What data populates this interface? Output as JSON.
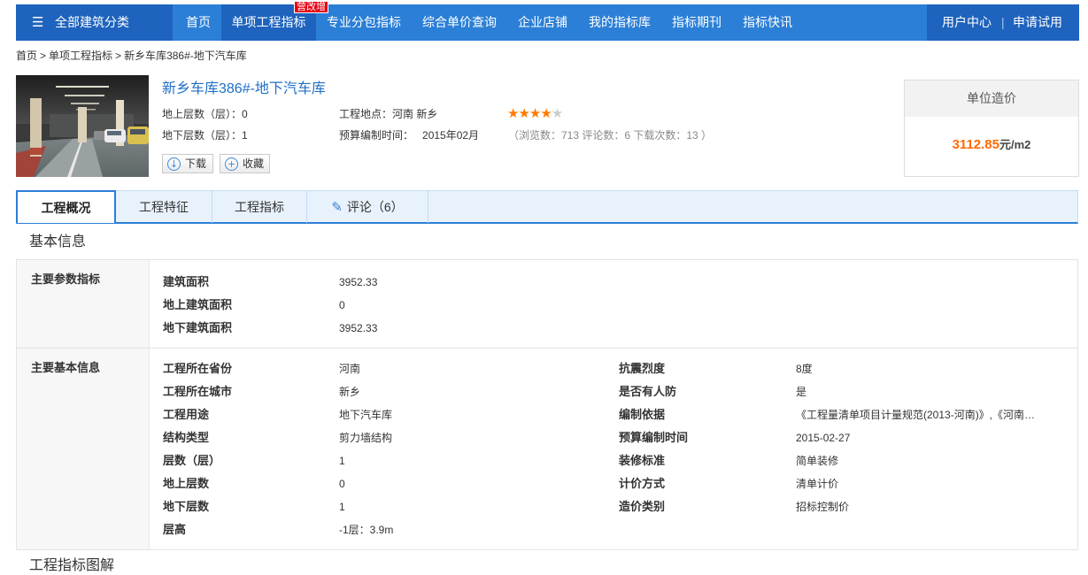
{
  "colors": {
    "nav_bg": "#2b7fd6",
    "nav_active": "#1e63bd",
    "badge": "#e60012",
    "link": "#1f6fc5",
    "price": "#ff6a00",
    "star_on": "#ff7a00",
    "star_off": "#cccccc"
  },
  "nav": {
    "category_icon": "menu-icon",
    "category_label": "全部建筑分类",
    "items": [
      {
        "label": "首页"
      },
      {
        "label": "单项工程指标",
        "badge": "营改增",
        "active": true
      },
      {
        "label": "专业分包指标"
      },
      {
        "label": "综合单价查询"
      },
      {
        "label": "企业店铺"
      },
      {
        "label": "我的指标库"
      },
      {
        "label": "指标期刊"
      },
      {
        "label": "指标快讯"
      }
    ],
    "user_center": "用户中心",
    "separator": "|",
    "trial": "申请试用"
  },
  "breadcrumb": {
    "separator": ">",
    "items": [
      "首页",
      "单项工程指标",
      "新乡车库386#-地下汽车库"
    ]
  },
  "project": {
    "title": "新乡车库386#-地下汽车库",
    "above_floors": "地上层数（层）：0",
    "below_floors": "地下层数（层）：1",
    "location": "工程地点：河南 新乡",
    "budget_time_label": "预算编制时间：",
    "budget_time": "2015年02月",
    "rating": 4,
    "rating_max": 5,
    "stats": "（浏览数：713 评论数：6 下载次数：13 ）",
    "download_label": "下载",
    "favorite_label": "收藏"
  },
  "unit_cost": {
    "title": "单位造价",
    "value": "3112.85",
    "unit": "元/m2"
  },
  "tabs": [
    {
      "label": "工程概况",
      "active": true
    },
    {
      "label": "工程特征"
    },
    {
      "label": "工程指标"
    },
    {
      "label": "评论（6）",
      "icon": "pencil-icon"
    }
  ],
  "basic_info": {
    "heading": "基本信息",
    "main_params": {
      "label": "主要参数指标",
      "rows": [
        {
          "name": "建筑面积",
          "value": "3952.33"
        },
        {
          "name": "地上建筑面积",
          "value": "0"
        },
        {
          "name": "地下建筑面积",
          "value": "3952.33"
        }
      ]
    },
    "main_info": {
      "label": "主要基本信息",
      "left": [
        {
          "name": "工程所在省份",
          "value": "河南"
        },
        {
          "name": "工程所在城市",
          "value": "新乡"
        },
        {
          "name": "工程用途",
          "value": "地下汽车库"
        },
        {
          "name": "结构类型",
          "value": "剪力墙结构"
        },
        {
          "name": "层数（层）",
          "value": "1"
        },
        {
          "name": "地上层数",
          "value": "0"
        },
        {
          "name": "地下层数",
          "value": "1"
        },
        {
          "name": "层高",
          "value": "-1层：3.9m"
        }
      ],
      "right": [
        {
          "name": "抗震烈度",
          "value": "8度"
        },
        {
          "name": "是否有人防",
          "value": "是"
        },
        {
          "name": "编制依据",
          "value": "《工程量清单项目计量规范(2013-河南)》,《河南…"
        },
        {
          "name": "预算编制时间",
          "value": "2015-02-27"
        },
        {
          "name": "装修标准",
          "value": "简单装修"
        },
        {
          "name": "计价方式",
          "value": "清单计价"
        },
        {
          "name": "造价类别",
          "value": "招标控制价"
        }
      ]
    }
  },
  "next_heading": "工程指标图解"
}
